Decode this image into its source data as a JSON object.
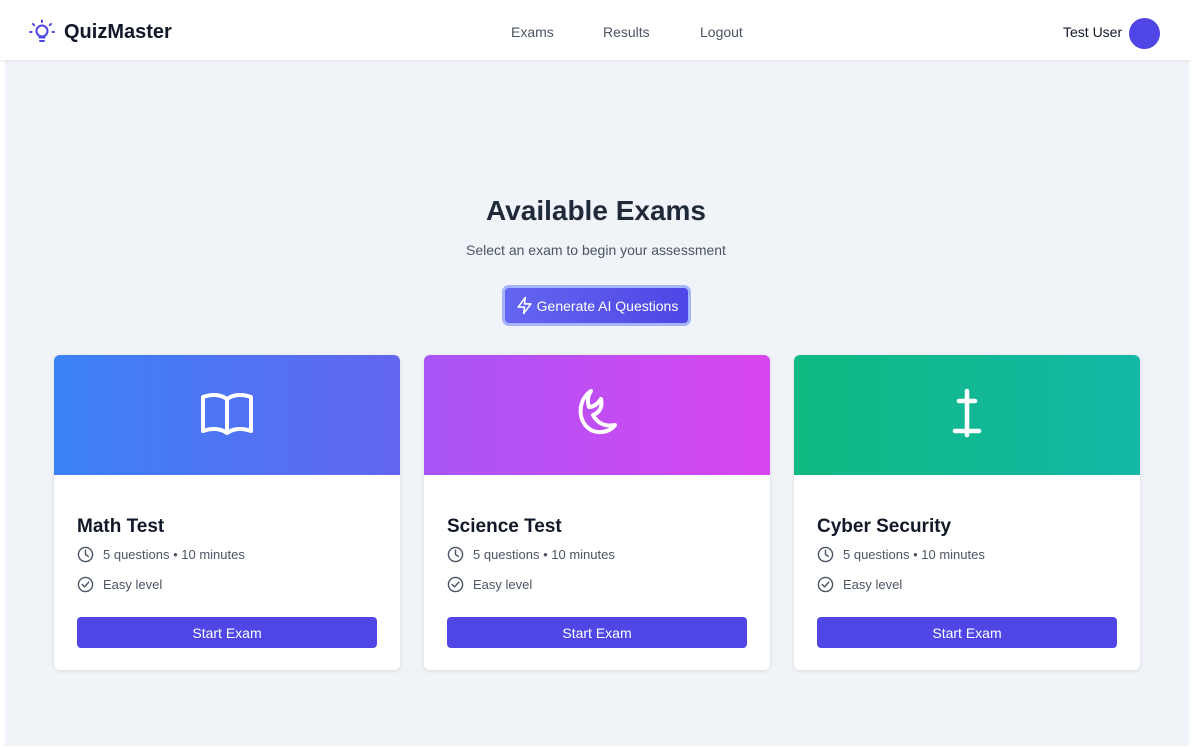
{
  "app": {
    "name": "QuizMaster"
  },
  "nav": {
    "exams": "Exams",
    "results": "Results",
    "logout": "Logout"
  },
  "user": {
    "name": "Test User"
  },
  "page": {
    "title": "Available Exams",
    "subtitle": "Select an exam to begin your assessment",
    "generate_button": "Generate AI Questions"
  },
  "exams": [
    {
      "title": "Math Test",
      "meta": "5 questions • 10 minutes",
      "level": "Easy level",
      "button": "Start Exam",
      "icon": "book-icon",
      "gradient": [
        "#3b82f6",
        "#6366f1"
      ]
    },
    {
      "title": "Science Test",
      "meta": "5 questions • 10 minutes",
      "level": "Easy level",
      "button": "Start Exam",
      "icon": "moon-icon",
      "gradient": [
        "#a855f7",
        "#d946ef"
      ]
    },
    {
      "title": "Cyber Security",
      "meta": "5 questions • 10 minutes",
      "level": "Easy level",
      "button": "Start Exam",
      "icon": "cursor-icon",
      "gradient": [
        "#10b981",
        "#14b8a6"
      ]
    }
  ],
  "colors": {
    "accent": "#4f46e5",
    "background": "#f0f3f7",
    "text": "#111827",
    "muted": "#4b5563"
  }
}
